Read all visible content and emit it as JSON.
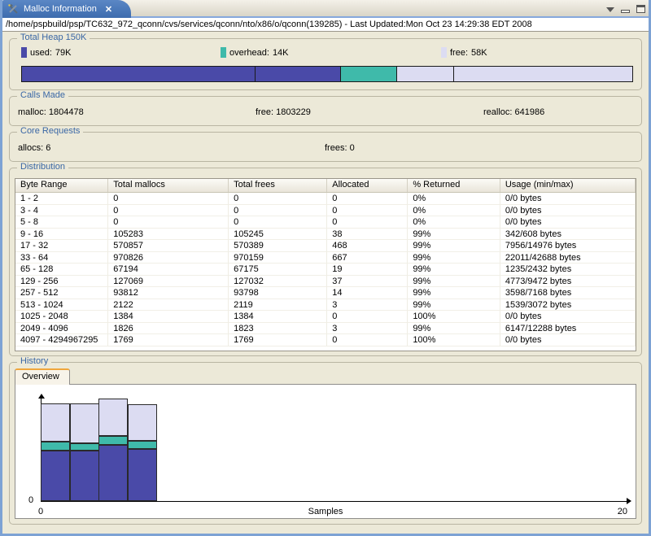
{
  "window": {
    "tab_title": "Malloc Information",
    "path_bar": "/home/pspbuild/psp/TC632_972_qconn/cvs/services/qconn/nto/x86/o/qconn(139285)  - Last Updated:Mon Oct 23 14:29:38 EDT 2008"
  },
  "icons": {
    "close": "✕"
  },
  "colors": {
    "used": "#4a4aa8",
    "overhead": "#3fbaaa",
    "free": "#dcdcf2"
  },
  "total_heap": {
    "title": "Total Heap 150K",
    "legend": [
      {
        "key": "used",
        "label": "used:",
        "value": "79K"
      },
      {
        "key": "overhead",
        "label": "overhead:",
        "value": "14K"
      },
      {
        "key": "free",
        "label": "free:",
        "value": "58K"
      }
    ],
    "bar_segments": [
      {
        "color_key": "used",
        "width_pct": 38.3
      },
      {
        "color_key": "used",
        "width_pct": 13.9
      },
      {
        "color_key": "overhead",
        "width_pct": 9.2
      },
      {
        "color_key": "free",
        "width_pct": 9.4
      },
      {
        "color_key": "free",
        "width_pct": 29.2
      }
    ]
  },
  "calls_made": {
    "title": "Calls Made",
    "stats": [
      {
        "label": "malloc:",
        "value": "1804478"
      },
      {
        "label": "free:",
        "value": "1803229"
      },
      {
        "label": "realloc:",
        "value": "641986"
      }
    ]
  },
  "core_requests": {
    "title": "Core Requests",
    "stats": [
      {
        "label": "allocs:",
        "value": "6"
      },
      {
        "label": "frees:",
        "value": "0"
      }
    ]
  },
  "distribution": {
    "title": "Distribution",
    "columns": [
      "Byte Range",
      "Total mallocs",
      "Total frees",
      "Allocated",
      "% Returned",
      "Usage (min/max)"
    ],
    "rows": [
      [
        "1 - 2",
        "0",
        "0",
        "0",
        "0%",
        "0/0 bytes"
      ],
      [
        "3 - 4",
        "0",
        "0",
        "0",
        "0%",
        "0/0 bytes"
      ],
      [
        "5 - 8",
        "0",
        "0",
        "0",
        "0%",
        "0/0 bytes"
      ],
      [
        "9 - 16",
        "105283",
        "105245",
        "38",
        "99%",
        "342/608 bytes"
      ],
      [
        "17 - 32",
        "570857",
        "570389",
        "468",
        "99%",
        "7956/14976 bytes"
      ],
      [
        "33 - 64",
        "970826",
        "970159",
        "667",
        "99%",
        "22011/42688 bytes"
      ],
      [
        "65 - 128",
        "67194",
        "67175",
        "19",
        "99%",
        "1235/2432 bytes"
      ],
      [
        "129 - 256",
        "127069",
        "127032",
        "37",
        "99%",
        "4773/9472 bytes"
      ],
      [
        "257 - 512",
        "93812",
        "93798",
        "14",
        "99%",
        "3598/7168 bytes"
      ],
      [
        "513 - 1024",
        "2122",
        "2119",
        "3",
        "99%",
        "1539/3072 bytes"
      ],
      [
        "1025 - 2048",
        "1384",
        "1384",
        "0",
        "100%",
        "0/0 bytes"
      ],
      [
        "2049 - 4096",
        "1826",
        "1823",
        "3",
        "99%",
        "6147/12288 bytes"
      ],
      [
        "4097 - 4294967295",
        "1769",
        "1769",
        "0",
        "100%",
        "0/0 bytes"
      ]
    ]
  },
  "history": {
    "title": "History",
    "tab_label": "Overview",
    "chart_data": {
      "type": "bar",
      "stacked": true,
      "x": [
        1,
        2,
        3,
        4
      ],
      "series": [
        {
          "name": "used",
          "values": [
            78,
            78,
            86,
            80
          ]
        },
        {
          "name": "overhead",
          "values": [
            13,
            11,
            14,
            12
          ]
        },
        {
          "name": "free",
          "values": [
            59,
            61,
            58,
            57
          ]
        }
      ],
      "units": "K",
      "xlabel": "Samples",
      "xlim": [
        0,
        20
      ],
      "x_min_label": "0",
      "x_max_label": "20",
      "y_min_label": "0",
      "legend_position": "none",
      "grid": false
    }
  }
}
